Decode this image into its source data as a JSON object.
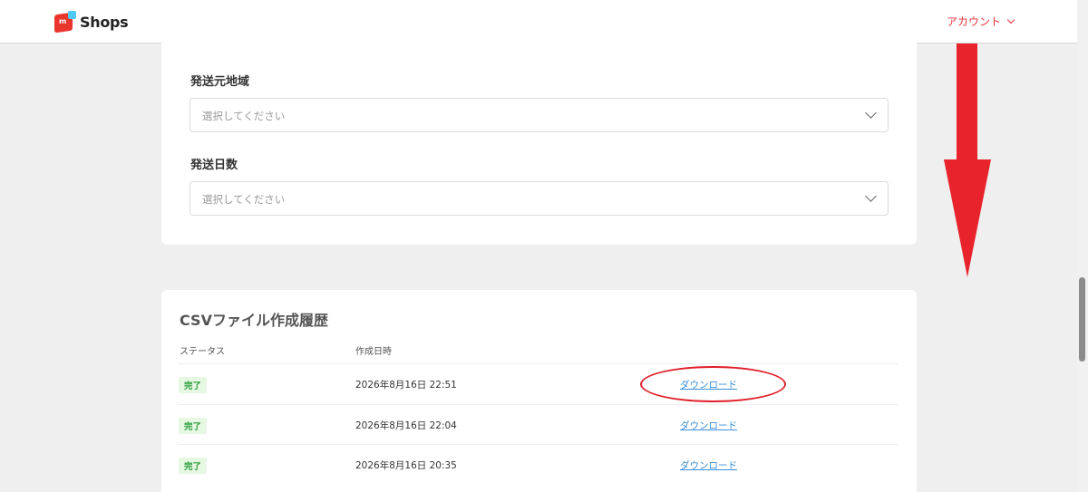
{
  "header": {
    "logo_text": "Shops",
    "logo_mark_letter": "m",
    "account_label": "アカウント"
  },
  "form": {
    "origin_label": "発送元地域",
    "origin_placeholder": "選択してください",
    "days_label": "発送日数",
    "days_placeholder": "選択してください"
  },
  "history": {
    "title": "CSVファイル作成履歴",
    "columns": [
      "ステータス",
      "作成日時"
    ],
    "rows": [
      {
        "status": "完了",
        "datetime": "2026年8月16日 22:51",
        "action": "ダウンロード"
      },
      {
        "status": "完了",
        "datetime": "2026年8月16日 22:04",
        "action": "ダウンロード"
      },
      {
        "status": "完了",
        "datetime": "2026年8月16日 20:35",
        "action": "ダウンロード"
      }
    ]
  },
  "colors": {
    "brand_red": "#ea352d",
    "brand_blue": "#4dc9f5",
    "link_blue": "#3a8fd8",
    "status_green": "#2a9d3b",
    "annotation_red": "#e0202a"
  },
  "icons": [
    "chevron-down-icon",
    "down-arrow-annotation"
  ]
}
